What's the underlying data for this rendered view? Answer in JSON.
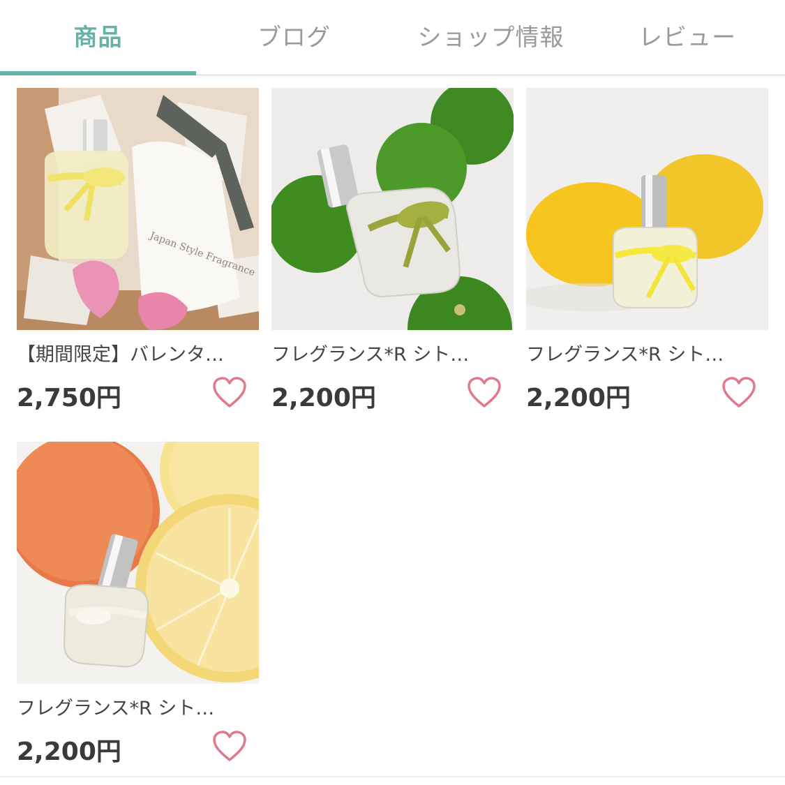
{
  "tabs": [
    {
      "label": "商品",
      "active": true
    },
    {
      "label": "ブログ",
      "active": false
    },
    {
      "label": "ショップ情報",
      "active": false
    },
    {
      "label": "レビュー",
      "active": false
    }
  ],
  "colors": {
    "accent": "#63b3a6",
    "favorite_heart": "#e0798d",
    "inactive_tab": "#9a9a9a"
  },
  "products": [
    {
      "title": "【期間限定】バレンタ…",
      "price": "2,750円",
      "image": "gift-box-perfume-bottle-with-pouch-and-pink-hearts",
      "favorite_icon": "heart-outline-icon"
    },
    {
      "title": "フレグランス*R シト…",
      "price": "2,200円",
      "image": "perfume-bottle-with-green-citrus",
      "favorite_icon": "heart-outline-icon"
    },
    {
      "title": "フレグランス*R シト…",
      "price": "2,200円",
      "image": "perfume-bottle-with-lemons",
      "favorite_icon": "heart-outline-icon"
    },
    {
      "title": "フレグランス*R シト…",
      "price": "2,200円",
      "image": "perfume-bottle-with-grapefruit",
      "favorite_icon": "heart-outline-icon"
    }
  ]
}
